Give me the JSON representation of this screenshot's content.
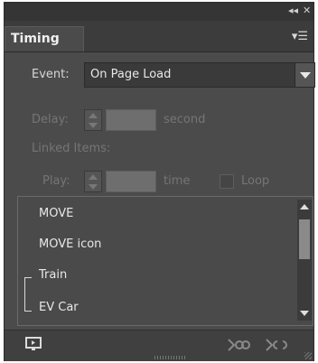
{
  "panel": {
    "tab_title": "Timing"
  },
  "event": {
    "label": "Event:",
    "selected": "On Page Load"
  },
  "delay": {
    "label": "Delay:",
    "unit": "second"
  },
  "linked_items": {
    "label": "Linked Items:"
  },
  "play": {
    "label": "Play:",
    "unit": "time",
    "loop_label": "Loop"
  },
  "list": {
    "items": [
      "MOVE",
      "MOVE icon",
      "Train",
      "EV Car"
    ]
  },
  "icons": {
    "collapse": "double-chevron-left-icon",
    "close": "close-icon",
    "panel_menu": "panel-menu-icon",
    "preview": "monitor-icon",
    "link": "link-icon",
    "unlink": "unlink-icon"
  }
}
